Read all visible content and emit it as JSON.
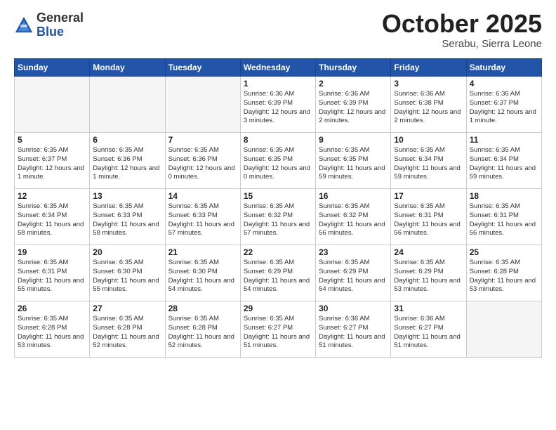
{
  "header": {
    "logo_general": "General",
    "logo_blue": "Blue",
    "month_title": "October 2025",
    "subtitle": "Serabu, Sierra Leone"
  },
  "calendar": {
    "weekdays": [
      "Sunday",
      "Monday",
      "Tuesday",
      "Wednesday",
      "Thursday",
      "Friday",
      "Saturday"
    ],
    "weeks": [
      [
        {
          "day": "",
          "info": ""
        },
        {
          "day": "",
          "info": ""
        },
        {
          "day": "",
          "info": ""
        },
        {
          "day": "1",
          "info": "Sunrise: 6:36 AM\nSunset: 6:39 PM\nDaylight: 12 hours and 3 minutes."
        },
        {
          "day": "2",
          "info": "Sunrise: 6:36 AM\nSunset: 6:39 PM\nDaylight: 12 hours and 2 minutes."
        },
        {
          "day": "3",
          "info": "Sunrise: 6:36 AM\nSunset: 6:38 PM\nDaylight: 12 hours and 2 minutes."
        },
        {
          "day": "4",
          "info": "Sunrise: 6:36 AM\nSunset: 6:37 PM\nDaylight: 12 hours and 1 minute."
        }
      ],
      [
        {
          "day": "5",
          "info": "Sunrise: 6:35 AM\nSunset: 6:37 PM\nDaylight: 12 hours and 1 minute."
        },
        {
          "day": "6",
          "info": "Sunrise: 6:35 AM\nSunset: 6:36 PM\nDaylight: 12 hours and 1 minute."
        },
        {
          "day": "7",
          "info": "Sunrise: 6:35 AM\nSunset: 6:36 PM\nDaylight: 12 hours and 0 minutes."
        },
        {
          "day": "8",
          "info": "Sunrise: 6:35 AM\nSunset: 6:35 PM\nDaylight: 12 hours and 0 minutes."
        },
        {
          "day": "9",
          "info": "Sunrise: 6:35 AM\nSunset: 6:35 PM\nDaylight: 11 hours and 59 minutes."
        },
        {
          "day": "10",
          "info": "Sunrise: 6:35 AM\nSunset: 6:34 PM\nDaylight: 11 hours and 59 minutes."
        },
        {
          "day": "11",
          "info": "Sunrise: 6:35 AM\nSunset: 6:34 PM\nDaylight: 11 hours and 59 minutes."
        }
      ],
      [
        {
          "day": "12",
          "info": "Sunrise: 6:35 AM\nSunset: 6:34 PM\nDaylight: 11 hours and 58 minutes."
        },
        {
          "day": "13",
          "info": "Sunrise: 6:35 AM\nSunset: 6:33 PM\nDaylight: 11 hours and 58 minutes."
        },
        {
          "day": "14",
          "info": "Sunrise: 6:35 AM\nSunset: 6:33 PM\nDaylight: 11 hours and 57 minutes."
        },
        {
          "day": "15",
          "info": "Sunrise: 6:35 AM\nSunset: 6:32 PM\nDaylight: 11 hours and 57 minutes."
        },
        {
          "day": "16",
          "info": "Sunrise: 6:35 AM\nSunset: 6:32 PM\nDaylight: 11 hours and 56 minutes."
        },
        {
          "day": "17",
          "info": "Sunrise: 6:35 AM\nSunset: 6:31 PM\nDaylight: 11 hours and 56 minutes."
        },
        {
          "day": "18",
          "info": "Sunrise: 6:35 AM\nSunset: 6:31 PM\nDaylight: 11 hours and 56 minutes."
        }
      ],
      [
        {
          "day": "19",
          "info": "Sunrise: 6:35 AM\nSunset: 6:31 PM\nDaylight: 11 hours and 55 minutes."
        },
        {
          "day": "20",
          "info": "Sunrise: 6:35 AM\nSunset: 6:30 PM\nDaylight: 11 hours and 55 minutes."
        },
        {
          "day": "21",
          "info": "Sunrise: 6:35 AM\nSunset: 6:30 PM\nDaylight: 11 hours and 54 minutes."
        },
        {
          "day": "22",
          "info": "Sunrise: 6:35 AM\nSunset: 6:29 PM\nDaylight: 11 hours and 54 minutes."
        },
        {
          "day": "23",
          "info": "Sunrise: 6:35 AM\nSunset: 6:29 PM\nDaylight: 11 hours and 54 minutes."
        },
        {
          "day": "24",
          "info": "Sunrise: 6:35 AM\nSunset: 6:29 PM\nDaylight: 11 hours and 53 minutes."
        },
        {
          "day": "25",
          "info": "Sunrise: 6:35 AM\nSunset: 6:28 PM\nDaylight: 11 hours and 53 minutes."
        }
      ],
      [
        {
          "day": "26",
          "info": "Sunrise: 6:35 AM\nSunset: 6:28 PM\nDaylight: 11 hours and 53 minutes."
        },
        {
          "day": "27",
          "info": "Sunrise: 6:35 AM\nSunset: 6:28 PM\nDaylight: 11 hours and 52 minutes."
        },
        {
          "day": "28",
          "info": "Sunrise: 6:35 AM\nSunset: 6:28 PM\nDaylight: 11 hours and 52 minutes."
        },
        {
          "day": "29",
          "info": "Sunrise: 6:35 AM\nSunset: 6:27 PM\nDaylight: 11 hours and 51 minutes."
        },
        {
          "day": "30",
          "info": "Sunrise: 6:36 AM\nSunset: 6:27 PM\nDaylight: 11 hours and 51 minutes."
        },
        {
          "day": "31",
          "info": "Sunrise: 6:36 AM\nSunset: 6:27 PM\nDaylight: 11 hours and 51 minutes."
        },
        {
          "day": "",
          "info": ""
        }
      ]
    ]
  }
}
